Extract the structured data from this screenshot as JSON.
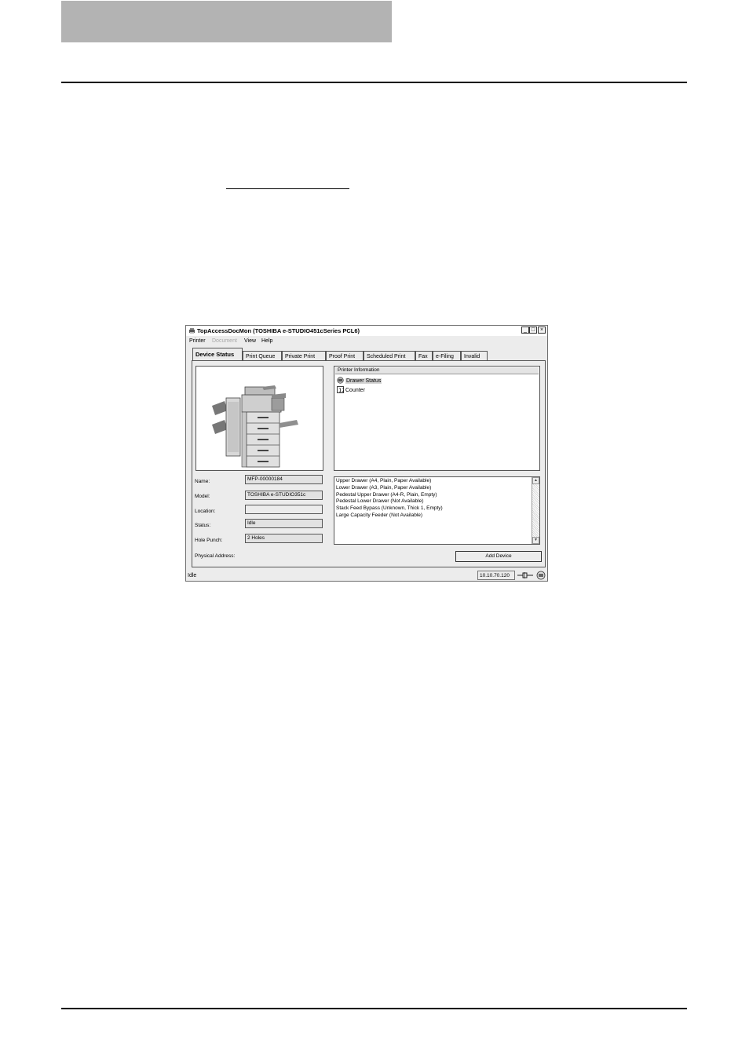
{
  "window": {
    "title": "TopAccessDocMon (TOSHIBA e-STUDIO451cSeries PCL6)",
    "controls": {
      "minimize": "_",
      "maximize": "□",
      "close": "×"
    }
  },
  "menu": {
    "items": [
      "Printer",
      "Document",
      "View",
      "Help"
    ],
    "disabled": [
      "Document"
    ]
  },
  "tabs": [
    "Device Status",
    "Print Queue",
    "Private Print",
    "Proof Print",
    "Scheduled Print",
    "Fax",
    "e-Filing",
    "Invalid"
  ],
  "active_tab": "Device Status",
  "printer_info": {
    "header": "Printer Information",
    "items": [
      {
        "label": "Drawer Status",
        "icon": "drawer-status-icon",
        "selected": true
      },
      {
        "label": "Counter",
        "icon": "counter-icon",
        "selected": false
      }
    ]
  },
  "device_fields": {
    "name_label": "Name:",
    "name_value": "MFP-00000184",
    "model_label": "Model:",
    "model_value": "TOSHIBA e-STUDIO351c",
    "location_label": "Location:",
    "location_value": "",
    "status_label": "Status:",
    "status_value": "Idle",
    "hole_punch_label": "Hole Punch:",
    "hole_punch_value": "2 Holes",
    "physical_address_label": "Physical Address:"
  },
  "drawer_status": [
    "Upper Drawer (A4, Plain, Paper Available)",
    "Lower Drawer (A3, Plain, Paper Available)",
    "Pedestal Upper Drawer (A4-R, Plain, Empty)",
    "Pedestal Lower Drawer (Not Available)",
    "Stack Feed Bypass (Unknown, Thick 1, Empty)",
    "Large Capacity Feeder (Not Available)"
  ],
  "buttons": {
    "add_device": "Add Device"
  },
  "statusbar": {
    "status": "Idle",
    "ip": "10.10.70.120"
  }
}
